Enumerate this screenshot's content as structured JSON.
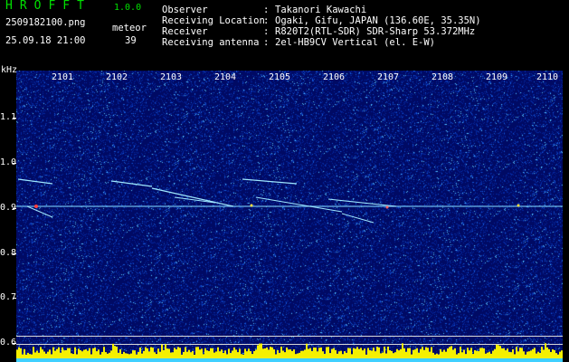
{
  "app": {
    "title": "HROFFT",
    "version": "1.0.0"
  },
  "file": {
    "name": "2509182100.png",
    "datetime": "25.09.18 21:00"
  },
  "meteor": {
    "label": "meteor",
    "count": "39"
  },
  "info": [
    {
      "key": "Observer",
      "value": "Takanori Kawachi"
    },
    {
      "key": "Receiving Location",
      "value": "Ogaki, Gifu, JAPAN (136.60E, 35.35N)"
    },
    {
      "key": "Receiver",
      "value": "R820T2(RTL-SDR) SDR-Sharp 53.372MHz"
    },
    {
      "key": "Receiving antenna",
      "value": "2el-HB9CV Vertical (el. E-W)"
    }
  ],
  "axes": {
    "y_unit": "kHz",
    "y_ticks": [
      "1.1",
      "1.0",
      "0.9",
      "0.8",
      "0.7",
      "0.6"
    ],
    "x_ticks": [
      "2101",
      "2102",
      "2103",
      "2104",
      "2105",
      "2106",
      "2107",
      "2108",
      "2109",
      "2110"
    ]
  },
  "colors": {
    "background": "#000000",
    "spectrogram": "#000a6a",
    "title_green": "#00e000",
    "trace": "#9fe8ff",
    "histogram": "#f5f000"
  }
}
